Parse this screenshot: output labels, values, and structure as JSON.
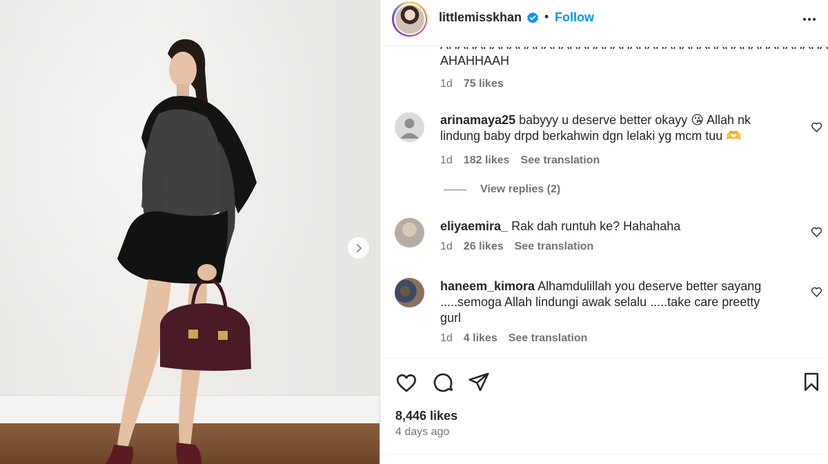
{
  "header": {
    "username": "littlemisskhan",
    "follow_label": "Follow",
    "separator": "•"
  },
  "comments": {
    "cut_comment": {
      "text": "AHAHAHAHAHAHAHAHAHAHAHAHAHAHAHAHAHAHAHAHAHAHAH AHAHHAAH",
      "time": "1d",
      "likes": "75 likes"
    },
    "items": [
      {
        "username": "arinamaya25",
        "text": " babyyy u deserve better okayy 😘 Allah nk lindung baby drpd berkahwin dgn lelaki yg mcm tuu 🫶",
        "time": "1d",
        "likes": "182 likes",
        "translate": "See translation"
      },
      {
        "username": "eliyaemira_",
        "text": " Rak dah runtuh ke? Hahahaha",
        "time": "1d",
        "likes": "26 likes",
        "translate": "See translation"
      },
      {
        "username": "haneem_kimora",
        "text": " Alhamdulillah you deserve better sayang .....semoga Allah lindungi awak selalu .....take care preetty gurl",
        "time": "1d",
        "likes": "4 likes",
        "translate": "See translation"
      }
    ],
    "view_replies": "View replies (2)"
  },
  "post": {
    "likes": "8,446 likes",
    "date": "4 days ago"
  },
  "colors": {
    "accent": "#0095f6",
    "text": "#262626",
    "muted": "#737373"
  },
  "icons": [
    "verified-badge-icon",
    "more-options-icon",
    "chevron-right-icon",
    "heart-icon",
    "comment-icon",
    "share-icon",
    "bookmark-icon",
    "default-avatar-icon"
  ]
}
